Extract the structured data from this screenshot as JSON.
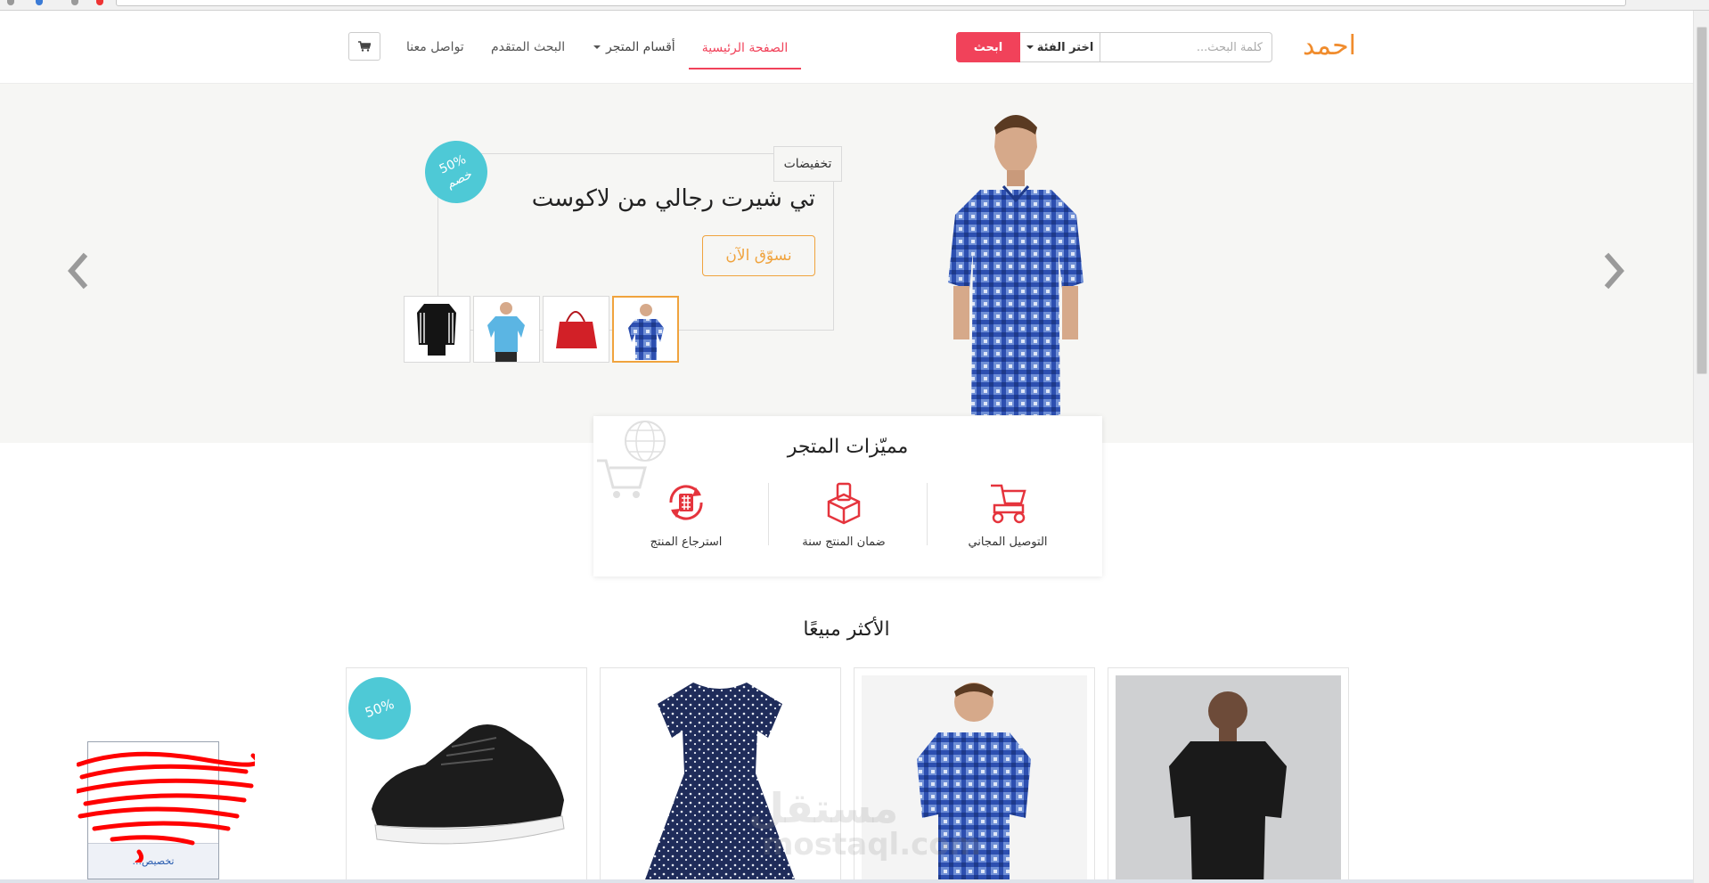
{
  "header": {
    "logo": "احمد",
    "search": {
      "placeholder": "كلمة البحث...",
      "category_label": "اختر الفئة",
      "button_label": "ابحث"
    },
    "nav": {
      "home": "الصفحة الرئيسية",
      "sections": "أقسام المتجر",
      "advanced_search": "البحث المتقدم",
      "contact": "تواصل معنا"
    },
    "cart_icon": "cart-icon"
  },
  "hero": {
    "tag": "تخفيضات",
    "badge_percent": "50%",
    "badge_text": "خصم",
    "title": "تي شيرت رجالي من لاكوست",
    "shop_button": "نسوّق الآن",
    "thumbnails": [
      "plaid-shirt",
      "red-bag",
      "blue-polo",
      "black-tracksuit"
    ],
    "active_thumbnail": 0,
    "colors": {
      "accent": "#f1425a",
      "orange": "#f0a33d",
      "teal": "#4ec9d6",
      "logo": "#f08c2d"
    }
  },
  "features": {
    "title": "مميّزات المتجر",
    "items": [
      {
        "icon": "delivery-scooter-icon",
        "label": "التوصيل المجاني"
      },
      {
        "icon": "product-guarantee-icon",
        "label": "ضمان المنتج سنة"
      },
      {
        "icon": "product-return-icon",
        "label": "استرجاع المنتج"
      }
    ]
  },
  "best_sellers": {
    "title": "الأكثر مبيعًا",
    "products": [
      {
        "image": "black-tshirt-model"
      },
      {
        "image": "plaid-shirt-model"
      },
      {
        "image": "polka-dot-dress"
      },
      {
        "image": "black-running-shoe",
        "badge": "50%"
      }
    ]
  },
  "watermark": {
    "arabic": "مستقل",
    "latin": "mostaql.com"
  },
  "widget": {
    "label": "تخصيص..."
  }
}
